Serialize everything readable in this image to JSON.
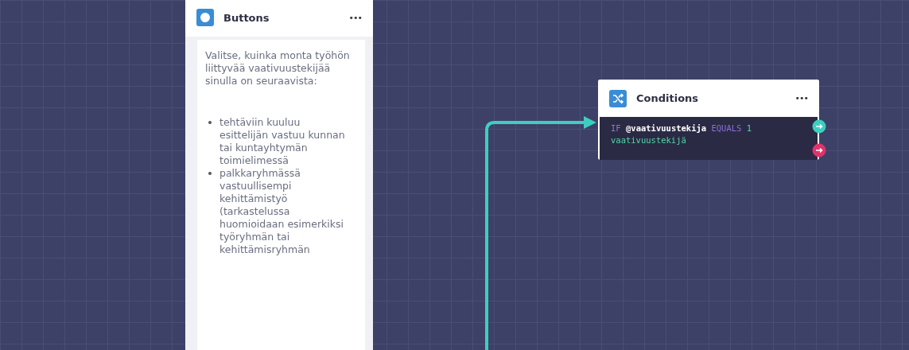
{
  "nodes": [
    {
      "kind": "buttons",
      "title": "Buttons",
      "menu": "•••",
      "paragraph": "Valitse, kuinka monta työhön liittyvää vaativuustekijää sinulla on seuraavista:",
      "bullets": [
        "tehtäviin kuuluu esittelijän vastuu kunnan tai kuntayhtymän toimielimessä",
        "palkkaryhmässä vastuullisempi kehittämistyö (tarkastelussa huomioidaan esimerkiksi työryhmän tai kehittämisryhmän"
      ]
    },
    {
      "kind": "conditions",
      "title": "Conditions",
      "menu": "•••",
      "condition": [
        {
          "kind": "keyword",
          "text": "IF"
        },
        {
          "kind": "variable",
          "text": "@vaativuustekija"
        },
        {
          "kind": "operator",
          "text": "EQUALS"
        },
        {
          "kind": "value",
          "text": "1 vaativuustekijä"
        }
      ]
    }
  ]
}
